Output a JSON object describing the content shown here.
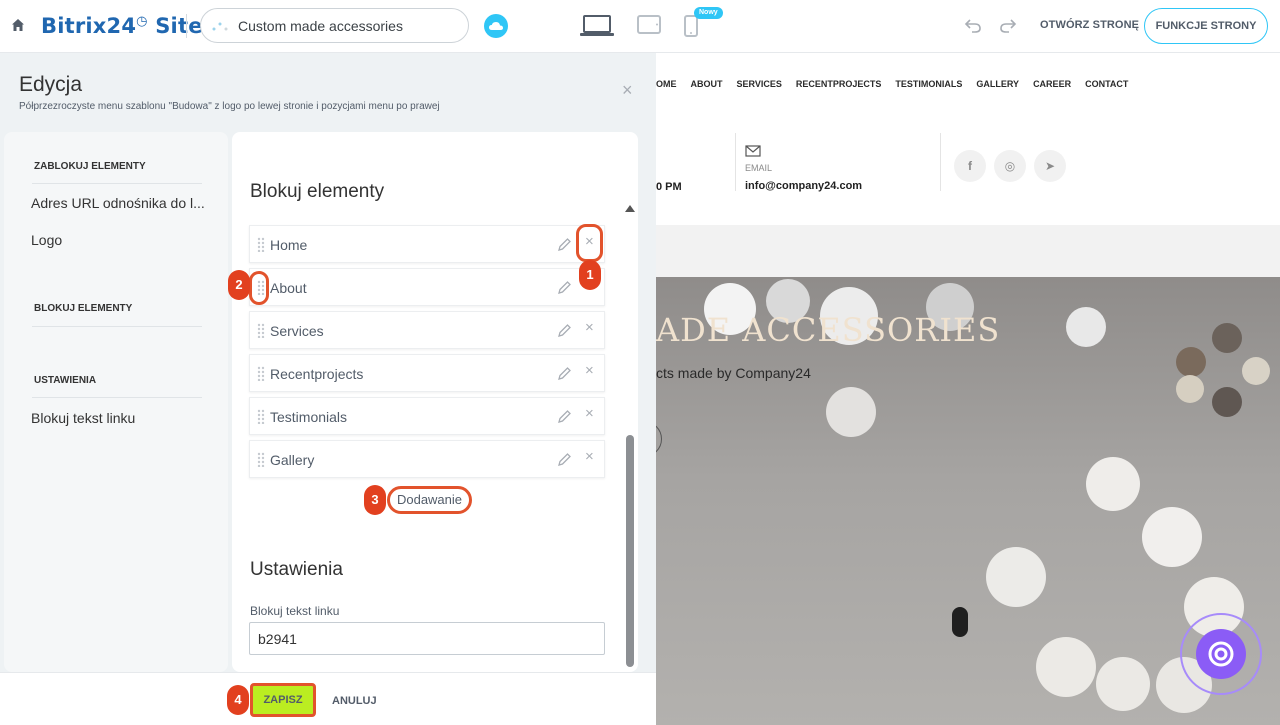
{
  "topbar": {
    "brand_part1": "Bitrix24",
    "brand_clock": "◷",
    "brand_part2": " Sites",
    "site_name": "Custom made accessories",
    "new_badge": "Nowy",
    "open_page_label": "OTWÓRZ STRONĘ",
    "page_functions_label": "FUNKCJE STRONY"
  },
  "editor": {
    "title": "Edycja",
    "description": "Półprzezroczyste menu szablonu \"Budowa\" z logo po lewej stronie i pozycjami menu po prawej",
    "close_glyph": "×",
    "side_nav": {
      "group1_heading": "ZABLOKUJ ELEMENTY",
      "group1_items": [
        "Adres URL odnośnika do l...",
        "Logo"
      ],
      "group2_heading": "BLOKUJ ELEMENTY",
      "group3_heading": "USTAWIENIA",
      "group3_items": [
        "Blokuj tekst linku"
      ]
    },
    "content": {
      "elements_title": "Blokuj elementy",
      "items": [
        {
          "label": "Home"
        },
        {
          "label": "About"
        },
        {
          "label": "Services"
        },
        {
          "label": "Recentprojects"
        },
        {
          "label": "Testimonials"
        },
        {
          "label": "Gallery"
        }
      ],
      "delete_glyph": "×",
      "add_button": "Dodawanie",
      "settings_title": "Ustawienia",
      "link_text_label": "Blokuj tekst linku",
      "link_text_value": "b2941"
    },
    "footer": {
      "save_label": "ZAPISZ",
      "cancel_label": "ANULUJ"
    }
  },
  "preview": {
    "nav": [
      "OME",
      "ABOUT",
      "SERVICES",
      "RECENTPROJECTS",
      "TESTIMONIALS",
      "GALLERY",
      "CAREER",
      "CONTACT"
    ],
    "hours_fragment": "0 PM",
    "email_label": "EMAIL",
    "email": "info@company24.com",
    "social": [
      "f",
      "◎",
      "➤"
    ],
    "hero_title": "ADE ACCESSORIES",
    "hero_subtitle": "cts made by Company24"
  },
  "annotations": [
    "1",
    "2",
    "3",
    "4"
  ],
  "colors": {
    "brand_blue": "#2067b0",
    "accent_cyan": "#2fc6f6",
    "save_green": "#bbed21",
    "annotation_red": "#e2532c",
    "assistant_purple": "#8b5cf6"
  }
}
